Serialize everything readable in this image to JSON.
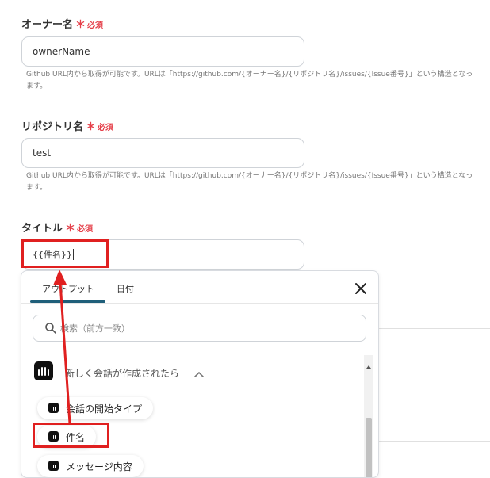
{
  "fields": {
    "owner": {
      "label": "オーナー名",
      "required_mark": "＊",
      "required_text": "必須",
      "value": "ownerName",
      "help_line1": "Github URL内から取得が可能です。URLは「https://github.com/{オーナー名}/{リポジトリ名}/issues/{Issue番号}」という構造となっ",
      "help_line2": "ます。"
    },
    "repo": {
      "label": "リポジトリ名",
      "required_mark": "＊",
      "required_text": "必須",
      "value": "test",
      "help_line1": "Github URL内から取得が可能です。URLは「https://github.com/{オーナー名}/{リポジトリ名}/issues/{Issue番号}」という構造となっ",
      "help_line2": "ます。"
    },
    "title": {
      "label": "タイトル",
      "required_mark": "＊",
      "required_text": "必須",
      "value": "{{件名}}"
    }
  },
  "picker": {
    "tabs": [
      "アウトプット",
      "日付"
    ],
    "active_tab": 0,
    "search_placeholder": "検索（前方一致）",
    "group_title": "新しく会話が作成されたら",
    "items": [
      "会話の開始タイプ",
      "件名",
      "メッセージ内容"
    ]
  },
  "colors": {
    "required": "#e5404a",
    "annotation_red": "#e02020",
    "tab_underline": "#1f5f7a"
  },
  "icons": {
    "close": "close-icon",
    "search": "search-icon",
    "app": "intercom-icon",
    "chevron": "chevron-up-icon"
  }
}
